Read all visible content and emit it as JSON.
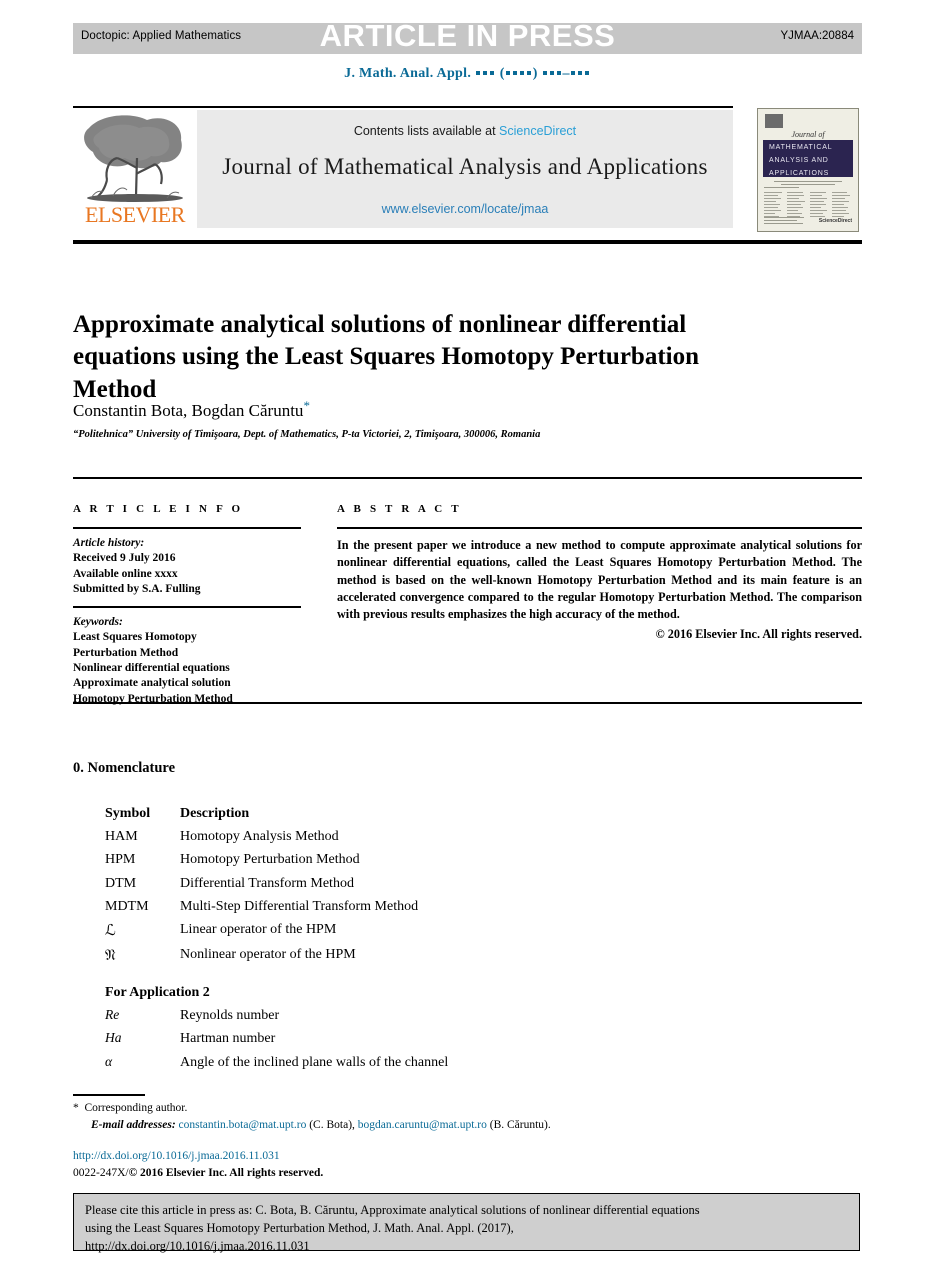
{
  "header": {
    "doctopic": "Doctopic: Applied Mathematics",
    "stamp": "ARTICLE IN PRESS",
    "code": "YJMAA:20884"
  },
  "journal_ref": {
    "prefix": "J. Math. Anal. Appl."
  },
  "masthead": {
    "contents_prefix": "Contents lists available at",
    "sciencedirect": "ScienceDirect",
    "journal_title": "Journal of Mathematical Analysis and Applications",
    "url": "www.elsevier.com/locate/jmaa",
    "publisher": "ELSEVIER"
  },
  "cover": {
    "journal_of": "Journal of",
    "line1": "MATHEMATICAL",
    "line2": "ANALYSIS AND",
    "line3": "APPLICATIONS",
    "sd_mark": "ScienceDirect"
  },
  "article": {
    "title": "Approximate analytical solutions of nonlinear differential equations using the Least Squares Homotopy Perturbation Method",
    "authors": "Constantin Bota, Bogdan Căruntu",
    "corresponding_marker": "*",
    "affiliation": "“Politehnica” University of Timişoara, Dept. of Mathematics, P-ta Victoriei, 2, Timişoara, 300006, Romania"
  },
  "info": {
    "heading": "A R T I C L E   I N F O",
    "history_label": "Article history:",
    "history": [
      "Received 9 July 2016",
      "Available online xxxx",
      "Submitted by S.A. Fulling"
    ],
    "keywords_label": "Keywords:",
    "keywords": [
      "Least Squares Homotopy",
      "Perturbation Method",
      "Nonlinear differential equations",
      "Approximate analytical solution",
      "Homotopy Perturbation Method"
    ]
  },
  "abstract": {
    "heading": "A B S T R A C T",
    "text": "In the present paper we introduce a new method to compute approximate analytical solutions for nonlinear differential equations, called the Least Squares Homotopy Perturbation Method. The method is based on the well-known Homotopy Perturbation Method and its main feature is an accelerated convergence compared to the regular Homotopy Perturbation Method. The comparison with previous results emphasizes the high accuracy of the method.",
    "copyright": "© 2016 Elsevier Inc. All rights reserved."
  },
  "nomenclature": {
    "heading": "0.  Nomenclature",
    "columns": [
      "Symbol",
      "Description"
    ],
    "rows": [
      {
        "symbol": "HAM",
        "description": "Homotopy Analysis Method"
      },
      {
        "symbol": "HPM",
        "description": "Homotopy Perturbation Method"
      },
      {
        "symbol": "DTM",
        "description": "Differential Transform Method"
      },
      {
        "symbol": "MDTM",
        "description": "Multi-Step Differential Transform Method"
      },
      {
        "symbol": "ℒ",
        "description": "Linear operator of the HPM"
      },
      {
        "symbol": "𝔑",
        "description": "Nonlinear operator of the HPM"
      }
    ],
    "subheading": "For Application 2",
    "rows2": [
      {
        "symbol": "Re",
        "description": "Reynolds number"
      },
      {
        "symbol": "Ha",
        "description": "Hartman number"
      },
      {
        "symbol": "α",
        "description": "Angle of the inclined plane walls of the channel"
      }
    ]
  },
  "footnote": {
    "star": "*",
    "corresponding": "Corresponding author.",
    "email_label": "E-mail addresses:",
    "email1": "constantin.bota@mat.upt.ro",
    "email1_name": "(C. Bota),",
    "email2": "bogdan.caruntu@mat.upt.ro",
    "email2_name": "(B. Căruntu)."
  },
  "doi_block": {
    "doi": "http://dx.doi.org/10.1016/j.jmaa.2016.11.031",
    "issn_prefix": "0022-247X/",
    "issn_rest": "© 2016 Elsevier Inc. All rights reserved."
  },
  "citation": {
    "line1": "Please cite this article in press as: C. Bota, B. Căruntu, Approximate analytical solutions of nonlinear differential equations",
    "line2": "using the Least Squares Homotopy Perturbation Method, J. Math. Anal. Appl. (2017),",
    "line3": "http://dx.doi.org/10.1016/j.jmaa.2016.11.031"
  },
  "colors": {
    "link": "#0a6a96",
    "sciencedirect": "#2a9fd6",
    "elsevier_orange": "#e87722",
    "bar_gray": "#c6c6c6",
    "cite_gray": "#cfcfcf",
    "cover_navy": "#2b2450"
  }
}
